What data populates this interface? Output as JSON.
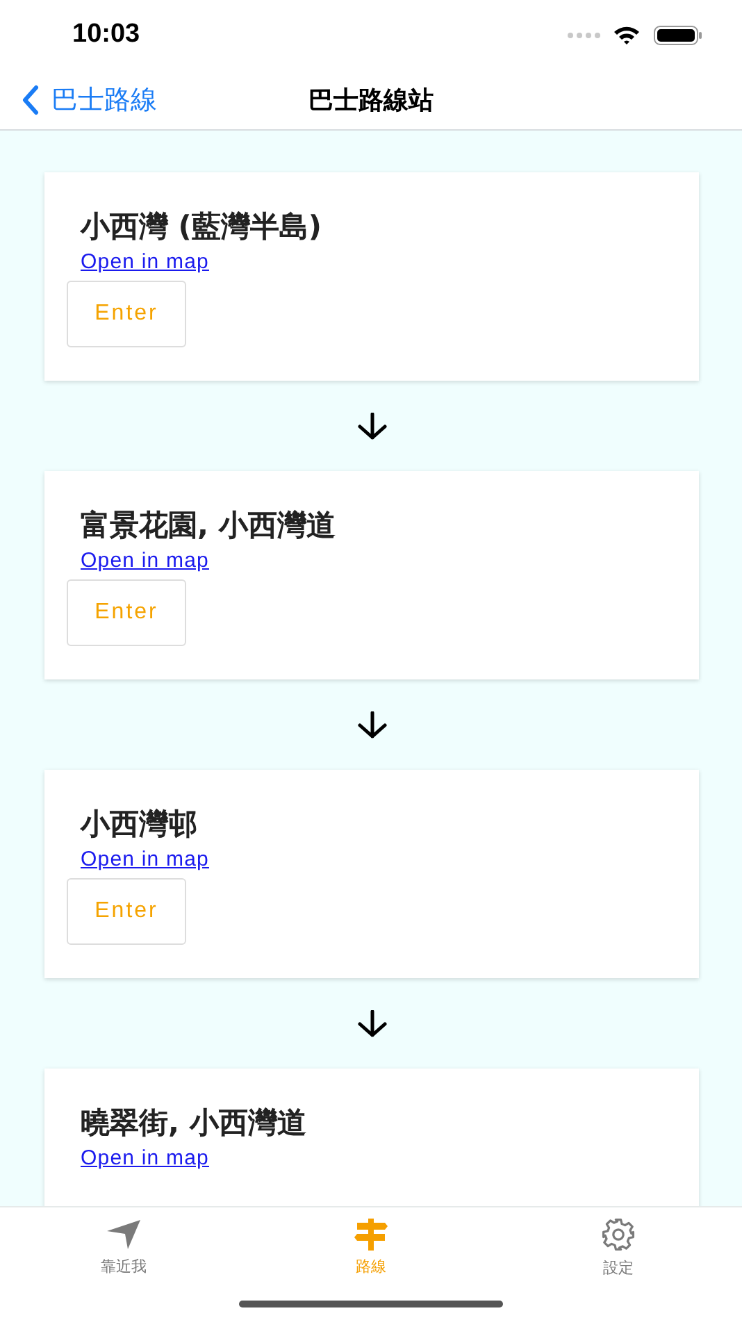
{
  "status_bar": {
    "time": "10:03"
  },
  "nav": {
    "back": "巴士路線",
    "title": "巴士路線站"
  },
  "stops": [
    {
      "name": "小西灣 (藍灣半島)",
      "link": "Open in map",
      "button": "Enter"
    },
    {
      "name": "富景花園, 小西灣道",
      "link": "Open in map",
      "button": "Enter"
    },
    {
      "name": "小西灣邨",
      "link": "Open in map",
      "button": "Enter"
    },
    {
      "name": "曉翠街, 小西灣道",
      "link": "Open in map"
    }
  ],
  "tabs": [
    {
      "label": "靠近我",
      "kind": "location",
      "selected": false
    },
    {
      "label": "路線",
      "kind": "signpost",
      "selected": true
    },
    {
      "label": "設定",
      "kind": "gear",
      "selected": false
    }
  ]
}
